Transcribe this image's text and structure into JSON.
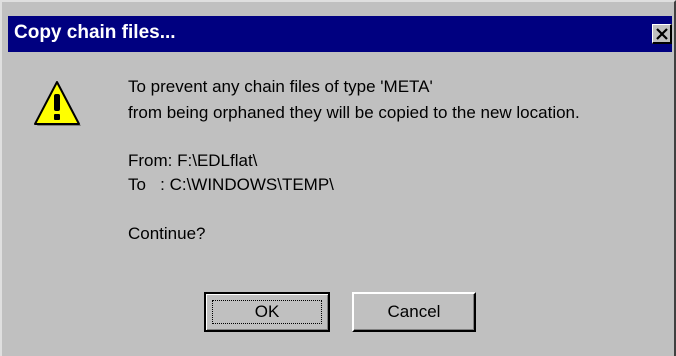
{
  "window": {
    "title": "Copy chain files...",
    "close_glyph": "✕"
  },
  "icon": "warning-icon",
  "message": {
    "line1": "To prevent any chain files of type 'META'",
    "line2": "from being orphaned they will be copied to the new location.",
    "from": "From: F:\\EDLflat\\",
    "to": "To   : C:\\WINDOWS\\TEMP\\",
    "question": "Continue?"
  },
  "buttons": {
    "ok": "OK",
    "cancel": "Cancel"
  },
  "colors": {
    "titlebar": "#000080",
    "face": "#c0c0c0",
    "warning_fill": "#ffff00"
  }
}
